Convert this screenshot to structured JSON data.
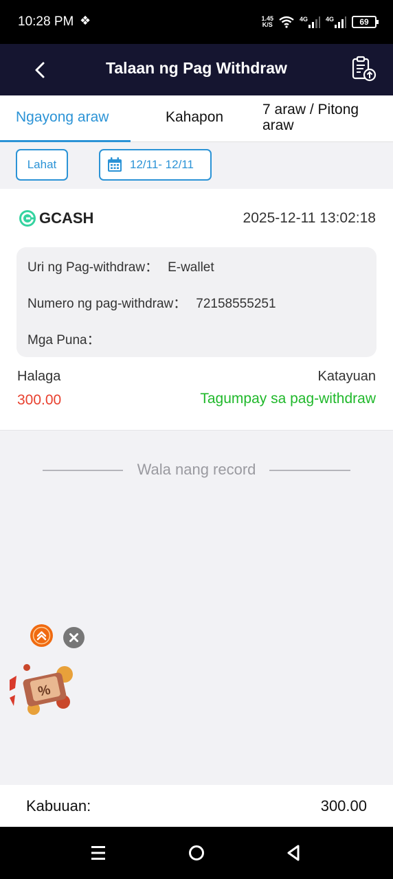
{
  "status_bar": {
    "time": "10:28 PM",
    "extra_glyph": "❖",
    "net_speed_top": "1.45",
    "net_speed_bottom": "K/S",
    "battery": "69"
  },
  "header": {
    "title": "Talaan ng Pag Withdraw",
    "back_icon": "chevron-left-icon",
    "action_icon": "clipboard-upload-icon"
  },
  "tabs": [
    {
      "label": "Ngayong araw",
      "active": true
    },
    {
      "label": "Kahapon",
      "active": false
    },
    {
      "label": "7 araw / Pitong araw",
      "active": false
    }
  ],
  "filters": {
    "all_label": "Lahat",
    "date_range": "12/11- 12/11"
  },
  "record": {
    "provider": "GCASH",
    "datetime": "2025-12-11 13:02:18",
    "type_label": "Uri ng Pag-withdraw：",
    "type_value": "E-wallet",
    "number_label": "Numero ng pag-withdraw：",
    "number_value": "72158555251",
    "remarks_label": "Mga Puna：",
    "remarks_value": "",
    "amount_label": "Halaga",
    "amount_value": "300.00",
    "status_label": "Katayuan",
    "status_value": "Tagumpay sa pag-withdraw"
  },
  "empty_text": "Wala nang record",
  "footer": {
    "total_label": "Kabuuan:",
    "total_value": "300.00"
  },
  "colors": {
    "accent": "#2b93d6",
    "header_bg": "#151530",
    "amount": "#e8412f",
    "success": "#1fb82a"
  }
}
